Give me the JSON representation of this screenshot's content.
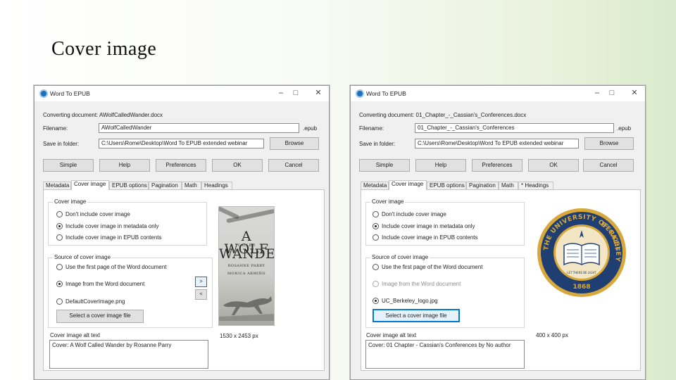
{
  "slide": {
    "title": "Cover image"
  },
  "windows": [
    {
      "title": "Word To EPUB",
      "converting_label": "Converting document:",
      "converting_doc": "AWolfCalledWander.docx",
      "filename_label": "Filename:",
      "filename_value": "AWolfCalledWander",
      "ext": ".epub",
      "savein_label": "Save in folder:",
      "savein_value": "C:\\Users\\Rome\\Desktop\\Word To EPUB extended webinar",
      "browse": "Browse",
      "buttons": [
        "Simple",
        "Help",
        "Preferences",
        "OK",
        "Cancel"
      ],
      "tabs": [
        "Metadata",
        "Cover image",
        "EPUB options",
        "Pagination",
        "Math",
        "Headings"
      ],
      "active_tab": 1,
      "group1": {
        "title": "Cover image",
        "options": [
          "Don't include cover image",
          "Include cover image in metadata only",
          "Include cover image in EPUB contents"
        ],
        "checked": 1
      },
      "group2": {
        "title": "Source of cover image",
        "options": [
          "Use the first page of the Word document",
          "Image from the Word document",
          "DefaultCoverImage.png"
        ],
        "checked": 1,
        "disabled": [],
        "select_button": "Select a cover image file",
        "nav": [
          ">",
          "<"
        ]
      },
      "alt_label": "Cover image alt text",
      "alt_text": "Cover: A Wolf Called Wander by Rosanne Parry",
      "dimensions": "1530 x 2453 px",
      "cover_art": {
        "title_line1": "A WOLF",
        "title_small": "CALLED",
        "title_line2": "WANDER",
        "author": "ROSANNE PARRY",
        "illustrator": "MONICA ARMIÑO"
      }
    },
    {
      "title": "Word To EPUB",
      "converting_label": "Converting document:",
      "converting_doc": "01_Chapter_-_Cassian's_Conferences.docx",
      "filename_label": "Filename:",
      "filename_value": "01_Chapter_-_Cassian's_Conferences",
      "ext": ".epub",
      "savein_label": "Save in folder:",
      "savein_value": "C:\\Users\\Rome\\Desktop\\Word To EPUB extended webinar",
      "browse": "Browse",
      "buttons": [
        "Simple",
        "Help",
        "Preferences",
        "OK",
        "Cancel"
      ],
      "tabs": [
        "Metadata",
        "Cover image",
        "EPUB options",
        "Pagination",
        "Math",
        "* Headings"
      ],
      "active_tab": 1,
      "group1": {
        "title": "Cover image",
        "options": [
          "Don't include cover image",
          "Include cover image in metadata only",
          "Include cover image in EPUB contents"
        ],
        "checked": 1
      },
      "group2": {
        "title": "Source of cover image",
        "options": [
          "Use the first page of the Word document",
          "Image from the Word document",
          "UC_Berkeley_logo.jpg"
        ],
        "checked": 2,
        "disabled": [
          1
        ],
        "select_button": "Select a cover image file",
        "nav": []
      },
      "alt_label": "Cover image alt text",
      "alt_text": "Cover: 01 Chapter - Cassian's Conferences by No author",
      "dimensions": "400 x 400 px",
      "seal": {
        "top_text": "THE UNIVERSITY OF CALIFORNIA",
        "side_text": "BERKELEY",
        "year": "1868",
        "motto": "LET THERE BE LIGHT"
      }
    }
  ],
  "colors": {
    "seal_blue": "#1f3f73",
    "seal_gold": "#d8a93a",
    "focus_blue": "#0078d7"
  }
}
